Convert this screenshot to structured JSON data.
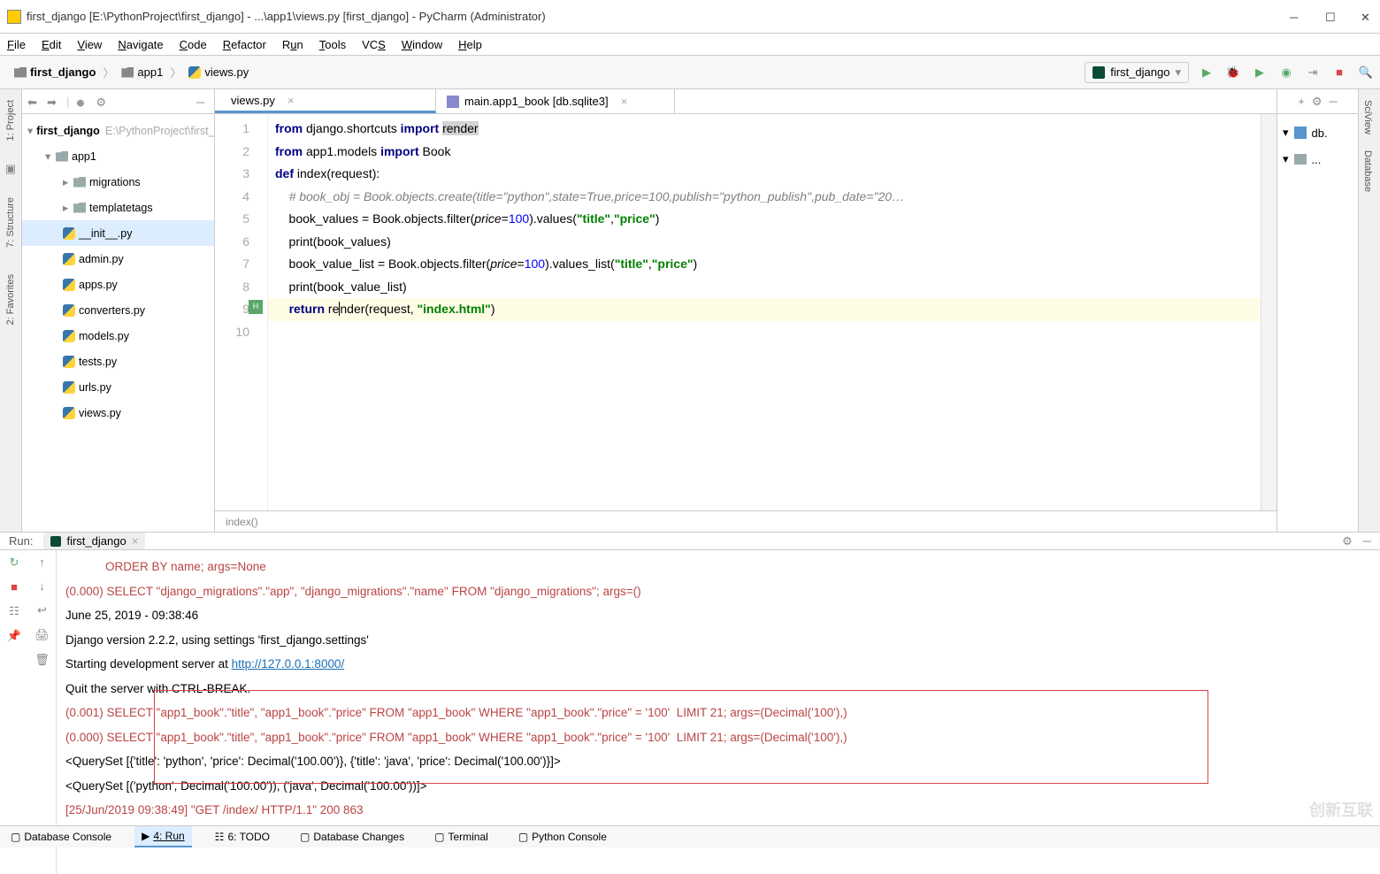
{
  "window": {
    "title": "first_django [E:\\PythonProject\\first_django] - ...\\app1\\views.py [first_django] - PyCharm (Administrator)"
  },
  "menu": [
    "File",
    "Edit",
    "View",
    "Navigate",
    "Code",
    "Refactor",
    "Run",
    "Tools",
    "VCS",
    "Window",
    "Help"
  ],
  "breadcrumbs": {
    "root": "first_django",
    "mid": "app1",
    "file": "views.py"
  },
  "run_config": "first_django",
  "project": {
    "root": "first_django",
    "root_path": "E:\\PythonProject\\first_django",
    "app1": "app1",
    "migrations": "migrations",
    "templatetags": "templatetags",
    "files": [
      "__init__.py",
      "admin.py",
      "apps.py",
      "converters.py",
      "models.py",
      "tests.py",
      "urls.py",
      "views.py"
    ]
  },
  "tabs": [
    {
      "label": "views.py",
      "active": true
    },
    {
      "label": "main.app1_book [db.sqlite3]",
      "active": false
    }
  ],
  "code": {
    "lines": [
      "from django.shortcuts import render",
      "from app1.models import Book",
      "def index(request):",
      "    # book_obj = Book.objects.create(title=\"python\",state=True,price=100,publish=\"python_publish\",pub_date=\"20…",
      "    book_values = Book.objects.filter(price=100).values(\"title\",\"price\")",
      "    print(book_values)",
      "    book_value_list = Book.objects.filter(price=100).values_list(\"title\",\"price\")",
      "    print(book_value_list)",
      "    return render(request, \"index.html\")"
    ],
    "breadcrumb": "index()"
  },
  "right_items": [
    "db.",
    "..."
  ],
  "run": {
    "label": "Run:",
    "config": "first_django",
    "output": [
      "            ORDER BY name; args=None",
      "(0.000) SELECT \"django_migrations\".\"app\", \"django_migrations\".\"name\" FROM \"django_migrations\"; args=()",
      "June 25, 2019 - 09:38:46",
      "Django version 2.2.2, using settings 'first_django.settings'",
      "Starting development server at http://127.0.0.1:8000/",
      "Quit the server with CTRL-BREAK.",
      "(0.001) SELECT \"app1_book\".\"title\", \"app1_book\".\"price\" FROM \"app1_book\" WHERE \"app1_book\".\"price\" = '100'  LIMIT 21; args=(Decimal('100'),)",
      "(0.000) SELECT \"app1_book\".\"title\", \"app1_book\".\"price\" FROM \"app1_book\" WHERE \"app1_book\".\"price\" = '100'  LIMIT 21; args=(Decimal('100'),)",
      "<QuerySet [{'title': 'python', 'price': Decimal('100.00')}, {'title': 'java', 'price': Decimal('100.00')}]>",
      "<QuerySet [('python', Decimal('100.00')), ('java', Decimal('100.00'))]>",
      "[25/Jun/2019 09:38:49] \"GET /index/ HTTP/1.1\" 200 863"
    ]
  },
  "bottom_tabs": [
    "Database Console",
    "4: Run",
    "6: TODO",
    "Database Changes",
    "Terminal",
    "Python Console"
  ],
  "left_tabs": [
    "1: Project",
    "7: Structure",
    "2: Favorites"
  ],
  "right_tabs": [
    "SciView",
    "Database"
  ],
  "watermark": "创新互联"
}
